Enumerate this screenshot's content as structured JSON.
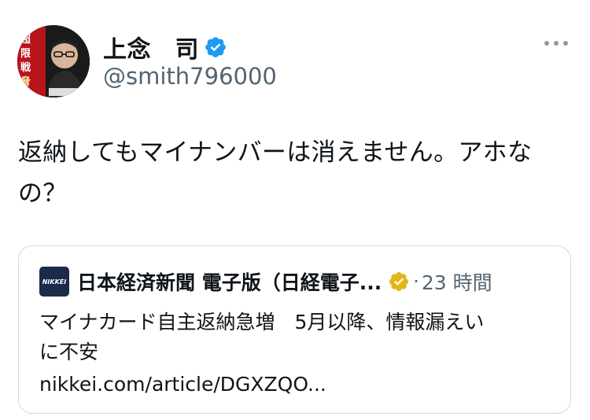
{
  "user": {
    "display_name": "上念　司",
    "handle": "@smith796000",
    "avatar_text": "「超限戦」の脅威"
  },
  "tweet": {
    "line1": "返納してもマイナンバーは消えません。アホな",
    "line2": "の？"
  },
  "card": {
    "logo_text": "NIKKEI",
    "source": "日本経済新聞 電子版（日経電子...",
    "separator": "·",
    "time": "23 時間",
    "text": "マイナカード自主返納急増　5月以降、情報漏えい\nに不安",
    "link": "nikkei.com/article/DGXZQO..."
  },
  "icons": {
    "verified": "verified-badge-icon",
    "gold_verified": "gold-verified-badge-icon",
    "more": "more-icon"
  },
  "colors": {
    "verified_blue": "#1d9bf0",
    "gold_badge": "#e2b719",
    "muted_text": "#536471",
    "nikkei_navy": "#1b2a4a"
  }
}
